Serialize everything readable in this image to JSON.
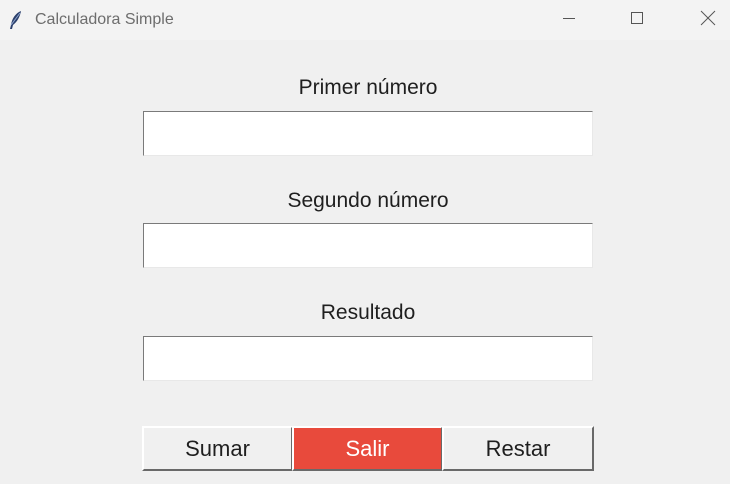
{
  "window": {
    "title": "Calculadora Simple",
    "icon": "feather-icon",
    "controls": [
      "minimize-icon",
      "maximize-icon",
      "close-icon"
    ]
  },
  "form": {
    "first_label": "Primer número",
    "first_value": "",
    "second_label": "Segundo número",
    "second_value": "",
    "result_label": "Resultado",
    "result_value": ""
  },
  "buttons": {
    "add_label": "Sumar",
    "exit_label": "Salir",
    "subtract_label": "Restar"
  },
  "colors": {
    "exit_button_bg": "#e84a3c",
    "window_bg": "#f0f0f0"
  }
}
